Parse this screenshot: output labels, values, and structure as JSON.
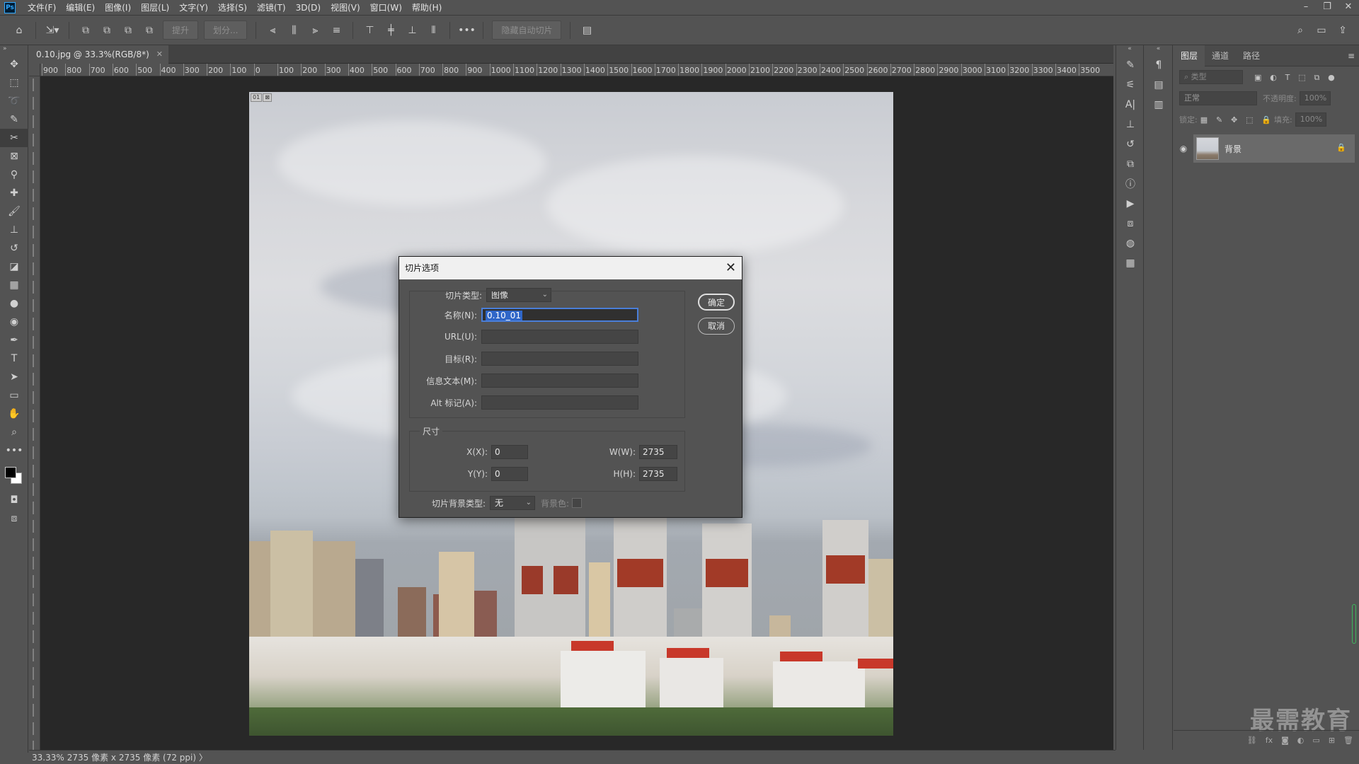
{
  "app": {
    "logo": "Ps",
    "menu": [
      "文件(F)",
      "编辑(E)",
      "图像(I)",
      "图层(L)",
      "文字(Y)",
      "选择(S)",
      "滤镜(T)",
      "3D(D)",
      "视图(V)",
      "窗口(W)",
      "帮助(H)"
    ]
  },
  "options_bar": {
    "promote_label": "提升",
    "divide_label": "划分...",
    "hide_auto_slices_label": "隐藏自动切片"
  },
  "document": {
    "tab_title": "0.10.jpg @ 33.3%(RGB/8*)",
    "slice_badge": [
      "01",
      "⊠"
    ],
    "ruler_h": [
      "900",
      "800",
      "700",
      "600",
      "500",
      "400",
      "300",
      "200",
      "100",
      "0",
      "100",
      "200",
      "300",
      "400",
      "500",
      "600",
      "700",
      "800",
      "900",
      "1000",
      "1100",
      "1200",
      "1300",
      "1400",
      "1500",
      "1600",
      "1700",
      "1800",
      "1900",
      "2000",
      "2100",
      "2200",
      "2300",
      "2400",
      "2500",
      "2600",
      "2700",
      "2800",
      "2900",
      "3000",
      "3100",
      "3200",
      "3300",
      "3400",
      "3500"
    ]
  },
  "dialog": {
    "title": "切片选项",
    "slice_type_label": "切片类型:",
    "slice_type_value": "图像",
    "name_label": "名称(N):",
    "name_value": "0.10_01",
    "url_label": "URL(U):",
    "url_value": "",
    "target_label": "目标(R):",
    "target_value": "",
    "message_label": "信息文本(M):",
    "message_value": "",
    "alt_label": "Alt 标记(A):",
    "alt_value": "",
    "ok_label": "确定",
    "cancel_label": "取消",
    "dimensions_title": "尺寸",
    "x_label": "X(X):",
    "x_value": "0",
    "y_label": "Y(Y):",
    "y_value": "0",
    "w_label": "W(W):",
    "w_value": "2735",
    "h_label": "H(H):",
    "h_value": "2735",
    "bg_type_label": "切片背景类型:",
    "bg_type_value": "无",
    "bg_color_label": "背景色:"
  },
  "layers_panel": {
    "tabs": [
      "图层",
      "通道",
      "路径"
    ],
    "filter_placeholder": "类型",
    "blend_mode": "正常",
    "opacity_label": "不透明度:",
    "opacity_value": "100%",
    "lock_label": "锁定:",
    "fill_label": "填充:",
    "fill_value": "100%",
    "layers": [
      {
        "name": "背景"
      }
    ],
    "footer_icons": [
      "link-icon",
      "fx-icon",
      "mask-icon",
      "adjustment-icon",
      "folder-icon",
      "new-layer-icon",
      "trash-icon"
    ],
    "fx_label": "fx"
  },
  "status_bar": {
    "zoom": "33.33%",
    "info": "2735 像素 x 2735 像素 (72 ppi)",
    "arrow": "〉"
  },
  "watermark": "最需教育"
}
